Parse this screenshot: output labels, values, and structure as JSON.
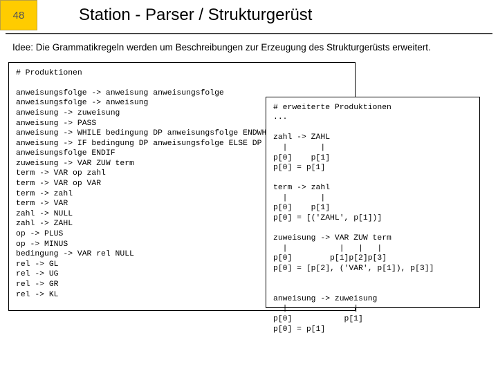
{
  "slide": {
    "number": "48",
    "title": "Station - Parser / Strukturgerüst",
    "idea": "Idee: Die Grammatikregeln werden um Beschreibungen zur Erzeugung des Strukturgerüsts erweitert.",
    "left_code": "# Produktionen\n\nanweisungsfolge -> anweisung anweisungsfolge\nanweisungsfolge -> anweisung\nanweisung -> zuweisung\nanweisung -> PASS\nanweisung -> WHILE bedingung DP anweisungsfolge ENDWH\nanweisung -> IF bedingung DP anweisungsfolge ELSE DP\nanweisungsfolge ENDIF\nzuweisung -> VAR ZUW term\nterm -> VAR op zahl\nterm -> VAR op VAR\nterm -> zahl\nterm -> VAR\nzahl -> NULL\nzahl -> ZAHL\nop -> PLUS\nop -> MINUS\nbedingung -> VAR rel NULL\nrel -> GL\nrel -> UG\nrel -> GR\nrel -> KL",
    "right_code": "# erweiterte Produktionen\n...\n\nzahl -> ZAHL\n  |       |\np[0]    p[1]\np[0] = p[1]\n\nterm -> zahl\n  |       |\np[0]    p[1]\np[0] = [('ZAHL', p[1])]\n\nzuweisung -> VAR ZUW term\n  |           |   |   |\np[0]        p[1]p[2]p[3]\np[0] = [p[2], ('VAR', p[1]), p[3]]\n\n\nanweisung -> zuweisung\n  |              |\np[0]           p[1]\np[0] = p[1]"
  }
}
